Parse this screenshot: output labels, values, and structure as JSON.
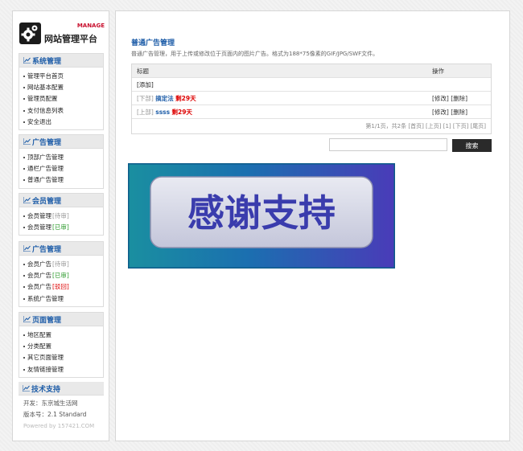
{
  "logo": {
    "badge": "MANAGE",
    "title": "网站管理平台"
  },
  "sidebar": {
    "groups": [
      {
        "title": "系统管理",
        "items": [
          {
            "label": "管理平台首页",
            "tag": ""
          },
          {
            "label": "网站基本配置",
            "tag": ""
          },
          {
            "label": "管理员配置",
            "tag": ""
          },
          {
            "label": "支付信息列表",
            "tag": ""
          },
          {
            "label": "安全退出",
            "tag": ""
          }
        ]
      },
      {
        "title": "广告管理",
        "items": [
          {
            "label": "顶部广告管理",
            "tag": ""
          },
          {
            "label": "通栏广告管理",
            "tag": ""
          },
          {
            "label": "普通广告管理",
            "tag": ""
          }
        ]
      },
      {
        "title": "会员管理",
        "items": [
          {
            "label": "会员管理",
            "tag": "[待审]"
          },
          {
            "label": "会员管理",
            "tag": "[已审]"
          }
        ]
      },
      {
        "title": "广告管理",
        "items": [
          {
            "label": "会员广告",
            "tag": "[待审]"
          },
          {
            "label": "会员广告",
            "tag": "[已审]"
          },
          {
            "label": "会员广告",
            "tag": "[驳回]"
          },
          {
            "label": "系统广告管理",
            "tag": ""
          }
        ]
      },
      {
        "title": "页面管理",
        "items": [
          {
            "label": "地区配置",
            "tag": ""
          },
          {
            "label": "分类配置",
            "tag": ""
          },
          {
            "label": "其它页面管理",
            "tag": ""
          },
          {
            "label": "友情链接管理",
            "tag": ""
          }
        ]
      }
    ],
    "support": {
      "title": "技术支持",
      "developer": "开发：东京城生活网",
      "version": "版本号：2.1 Standard",
      "powered": "Powered by 157421.COM"
    }
  },
  "main": {
    "title": "普通广告管理",
    "description": "普通广告管理，用于上传或修改位于页面内的图片广告。格式为188*75像素的GIF/JPG/SWF文件。",
    "table": {
      "headers": [
        "标题",
        "操作"
      ],
      "add_link": "[添加]",
      "rows": [
        {
          "position": "[下部]",
          "name": "搞定法",
          "remain": "剩29天",
          "edit": "[修改]",
          "delete": "[删除]"
        },
        {
          "position": "[上部]",
          "name": "ssss",
          "remain": "剩29天",
          "edit": "[修改]",
          "delete": "[删除]"
        }
      ],
      "pager": "第1/1页，共2条 [首页] [上页] [1] [下页] [尾页]"
    },
    "search": {
      "value": "",
      "button": "搜索"
    },
    "banner": {
      "text": "感谢支持"
    }
  },
  "colors": {
    "accent_blue": "#1e5da8",
    "alert_red": "#dd0000",
    "approved_green": "#2b9a2b"
  }
}
